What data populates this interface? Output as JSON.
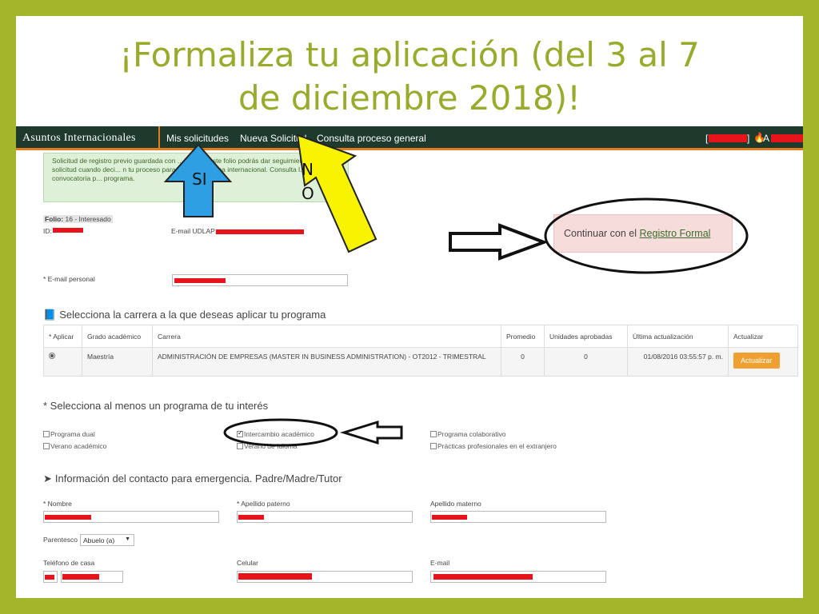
{
  "slide": {
    "title_line1": "¡Formaliza tu aplicación (del 3 al 7",
    "title_line2": "de diciembre 2018)!"
  },
  "nav": {
    "brand": "Asuntos Internacionales",
    "links": [
      "Mis solicitudes",
      "Nueva Solicitud",
      "Consulta proceso general"
    ],
    "user_prefix": "[",
    "user_suffix": "]",
    "user_mid": "A"
  },
  "alert": {
    "text": "Solicitud de registro previo guardada con ... 6]. Con este folio podrás dar seguimiento a tu solicitud cuando deci... n tu proceso para real... programa internacional. Consulta l... de la convocatoria p... programa."
  },
  "folio": {
    "label": "Folio:",
    "value": "16 - Interesado"
  },
  "id_label": "ID:",
  "email_udlap_label": "E-mail UDLAP:",
  "email_personal_label": "* E-mail personal",
  "continue_box": {
    "prefix": "Continuar con el ",
    "link": "Registro Formal"
  },
  "carrera": {
    "heading": "Selecciona la carrera a la que deseas aplicar tu programa",
    "headers": [
      "* Aplicar",
      "Grado académico",
      "Carrera",
      "Promedio",
      "Unidades aprobadas",
      "Última actualización",
      "Actualizar"
    ],
    "row": {
      "grado": "Maestría",
      "carrera": "ADMINISTRACIÓN DE EMPRESAS (MASTER IN BUSINESS ADMINISTRATION) - OT2012 - TRIMESTRAL",
      "promedio": "0",
      "unidades": "0",
      "fecha": "01/08/2016 03:55:57 p. m.",
      "button": "Actualizar"
    }
  },
  "programas": {
    "heading": "* Selecciona al menos un programa de tu interés",
    "items": [
      "Programa dual",
      "Verano académico",
      "Intercambio académico",
      "Verano de Idioma",
      "Programa colaborativo",
      "Prácticas profesionales en el extranjero"
    ]
  },
  "contacto": {
    "heading": "Información del contacto para emergencia. Padre/Madre/Tutor",
    "nombre": "* Nombre",
    "ap_paterno": "* Apellido paterno",
    "ap_materno": "Apellido materno",
    "parentesco_label": "Parentesco",
    "parentesco_value": "Abuelo (a)",
    "tel_casa": "Teléfono de casa",
    "celular": "Celular",
    "email": "E-mail"
  },
  "annotations": {
    "si": "SI",
    "no_line1": "N",
    "no_line2": "O"
  },
  "colors": {
    "background": "#a3b52a",
    "title": "#9aaa2a",
    "nav": "#1d3a2c",
    "nav_accent": "#e07b1f",
    "redaction": "#e8141c",
    "arrow_blue": "#2f9fe4",
    "arrow_yellow": "#f8f400"
  }
}
